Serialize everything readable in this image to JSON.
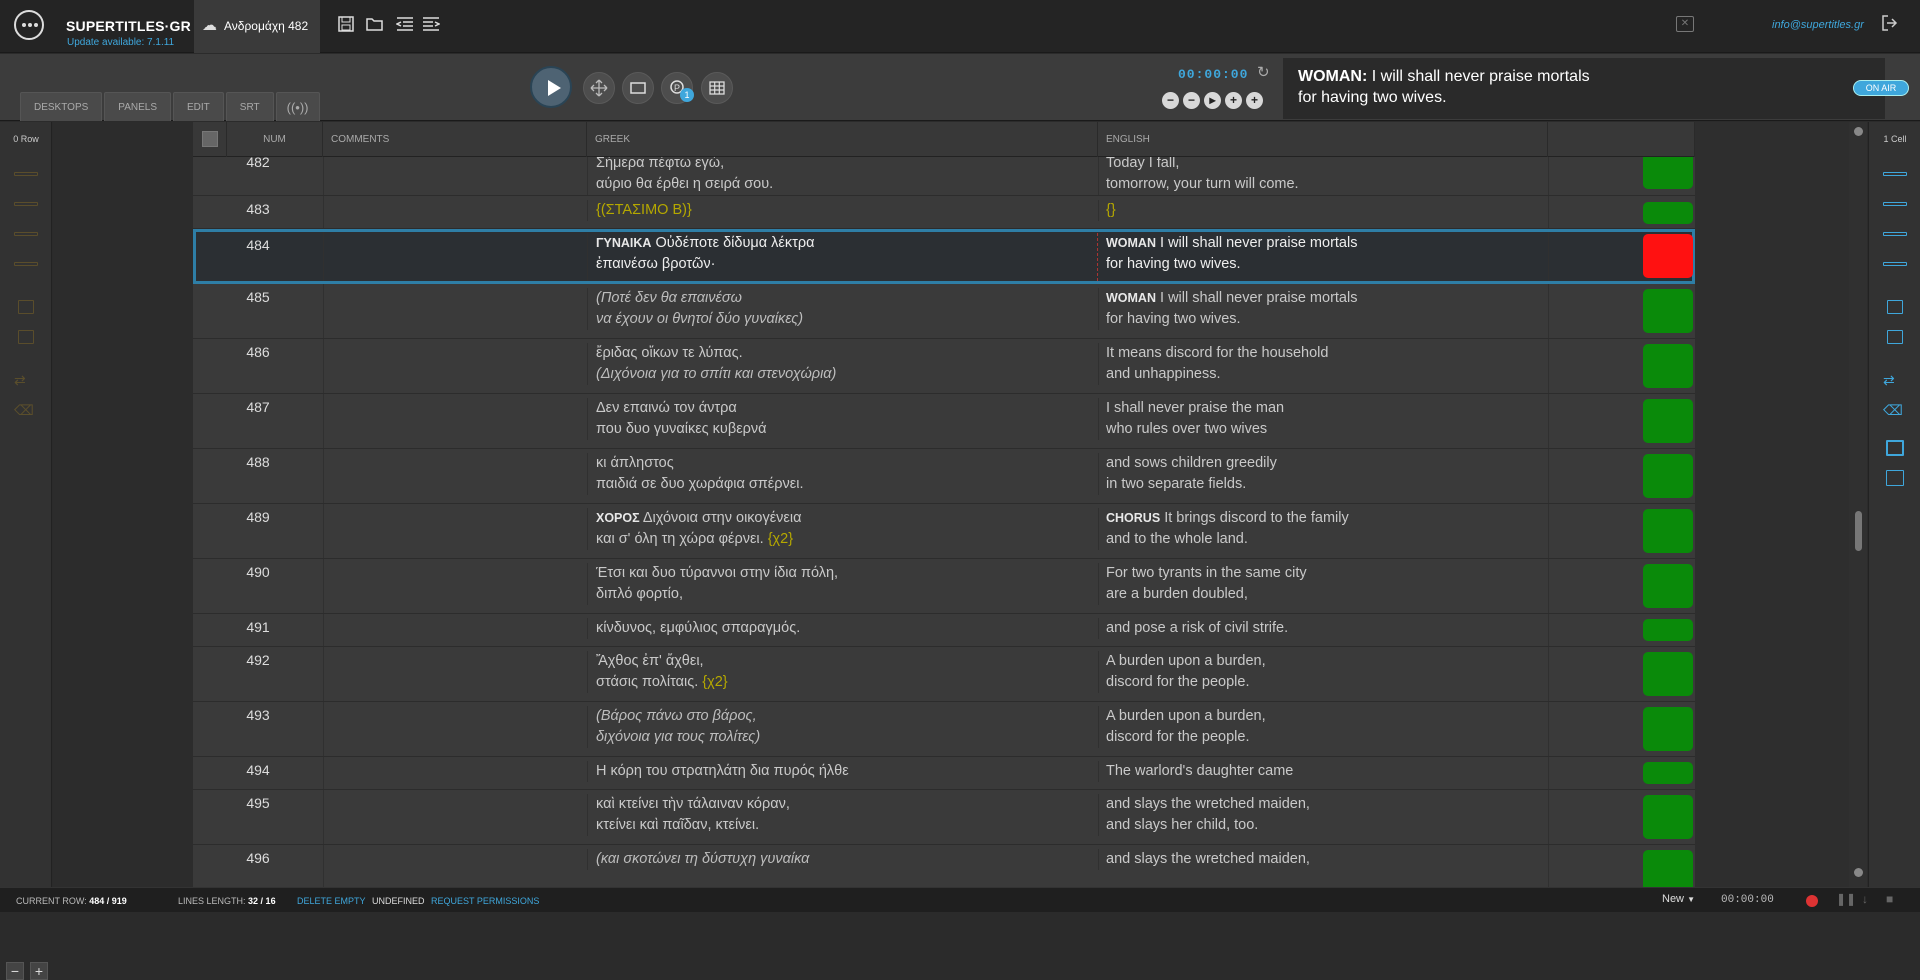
{
  "app": {
    "brand": "SUPERTITLES·GR",
    "update_notice": "Update available: 7.1.11",
    "project_name": "Ανδρομάχη 482",
    "email": "info@supertitles.gr"
  },
  "tabs": [
    "DESKTOPS",
    "PANELS",
    "EDIT",
    "SRT"
  ],
  "player": {
    "timer": "00:00:00",
    "badge": "1",
    "preview_speaker": "WOMAN:",
    "preview_line1": "I will shall never praise mortals",
    "preview_line2": "for having two wives.",
    "on_air_label": "ON AIR"
  },
  "sidebar": {
    "left_label": "0 Row",
    "right_label": "1 Cell"
  },
  "columns": {
    "num": "NUM",
    "comments": "COMMENTS",
    "greek": "GREEK",
    "english": "ENGLISH"
  },
  "rows": [
    {
      "num": "482",
      "gr1": "Σήμερα πέφτω εγώ,",
      "gr2": "αύριο θα έρθει η σειρά σου.",
      "en1": "Today I fall,",
      "en2": "tomorrow, your turn will come.",
      "status": "green"
    },
    {
      "num": "483",
      "gr1": "{(ΣΤΑΣΙΜΟ Β)}",
      "gr2": "",
      "en1": "{}",
      "en2": "",
      "status": "green"
    },
    {
      "num": "484",
      "gr_spk": "ΓΥΝΑΙΚΑ",
      "gr1": "Οὐδέποτε δίδυμα λέκτρα",
      "gr2": "ἐπαινέσω βροτῶν·",
      "en_spk": "WOMAN",
      "en1": "I will shall never praise mortals",
      "en2": "for having two wives.",
      "status": "red"
    },
    {
      "num": "485",
      "gr1": "(Ποτέ δεν θα επαινέσω",
      "gr2": "να έχουν οι θνητοί δύο γυναίκες)",
      "en_spk": "WOMAN",
      "en1": "I will shall never praise mortals",
      "en2": "for having two wives.",
      "status": "green"
    },
    {
      "num": "486",
      "gr1": "ἔριδας οἴκων τε λύπας.",
      "gr2": "(Διχόνοια για το σπίτι και στενοχώρια)",
      "en1": "It means discord for the household",
      "en2": "and unhappiness.",
      "status": "green"
    },
    {
      "num": "487",
      "gr1": "Δεν επαινώ τον άντρα",
      "gr2": "που δυο γυναίκες κυβερνά",
      "en1": "I shall never praise the man",
      "en2": "who rules over two wives",
      "status": "green"
    },
    {
      "num": "488",
      "gr1": "κι άπληστος",
      "gr2": "παιδιά σε δυο χωράφια σπέρνει.",
      "en1": "and sows children greedily",
      "en2": "in two separate fields.",
      "status": "green"
    },
    {
      "num": "489",
      "gr_spk": "ΧΟΡΟΣ",
      "gr1": "Διχόνοια στην οικογένεια",
      "gr2": "και σ' όλη τη χώρα φέρνει.",
      "gr2_tag": "{χ2}",
      "en_spk": "CHORUS",
      "en1": "It brings discord to the family",
      "en2": "and to the whole land.",
      "status": "green"
    },
    {
      "num": "490",
      "gr1": "Έτσι και δυο τύραννοι στην ίδια πόλη,",
      "gr2": "διπλό φορτίο,",
      "en1": "For two tyrants in the same city",
      "en2": "are a burden doubled,",
      "status": "green"
    },
    {
      "num": "491",
      "gr1": "κίνδυνος, εμφύλιος σπαραγμός.",
      "gr2": "",
      "en1": "and pose a risk of civil strife.",
      "en2": "",
      "status": "green"
    },
    {
      "num": "492",
      "gr1": "Ἄχθος ἐπ' ἄχθει,",
      "gr2": "στάσις πολίταις.",
      "gr2_tag": "{χ2}",
      "en1": "A burden upon a burden,",
      "en2": "discord for the people.",
      "status": "green"
    },
    {
      "num": "493",
      "gr1": "(Βάρος πάνω στο βάρος,",
      "gr2": "διχόνοια για τους πολίτες)",
      "en1": "A burden upon a burden,",
      "en2": "discord for the people.",
      "status": "green"
    },
    {
      "num": "494",
      "gr1": "Η κόρη του στρατηλάτη δια πυρός ήλθε",
      "gr2": "",
      "en1": "The warlord's daughter came",
      "en2": "",
      "status": "green"
    },
    {
      "num": "495",
      "gr1": "καὶ κτείνει τὴν τάλαιναν κόραν,",
      "gr2": "κτείνει καὶ παῖδαν, κτείνει.",
      "en1": "and slays the wretched maiden,",
      "en2": "and slays her child, too.",
      "status": "green"
    },
    {
      "num": "496",
      "gr1": "(και σκοτώνει τη δύστυχη γυναίκα",
      "gr2": "",
      "en1": "and slays the wretched maiden,",
      "en2": "",
      "status": "green"
    }
  ],
  "footer": {
    "current_row_label": "CURRENT ROW:",
    "current_row_value": "484 / 919",
    "lines_length_label": "LINES LENGTH:",
    "lines_length_value": "32 / 16",
    "delete_empty": "DELETE EMPTY",
    "undefined": "UNDEFINED",
    "request_permissions": "REQUEST PERMISSIONS",
    "new_label": "New",
    "timecode": "00:00:00"
  },
  "colors": {
    "accent": "#3fa7dc",
    "status_ok": "#0a8a0a",
    "status_active": "#ff1111",
    "tag": "#b5a800"
  }
}
